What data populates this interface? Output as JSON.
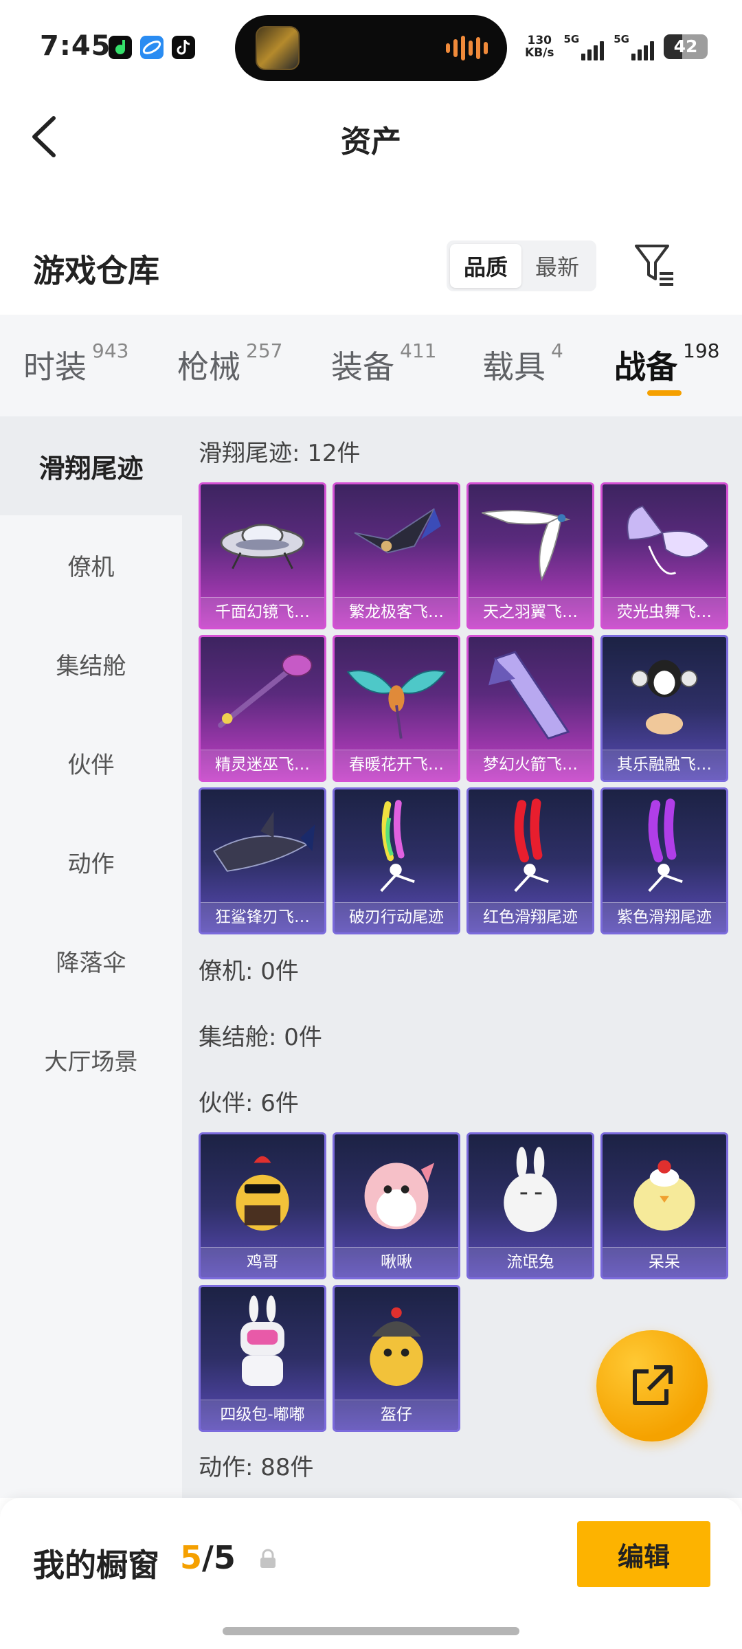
{
  "status_bar": {
    "time": "7:45",
    "net_speed_value": "130",
    "net_speed_unit": "KB/s",
    "sim1": "5G",
    "sim2": "5G",
    "battery": "42",
    "battery_level": 0.42,
    "app_icons": [
      "music-app-icon",
      "browser-app-icon",
      "tiktok-icon"
    ]
  },
  "nav": {
    "title": "资产"
  },
  "warehouse": {
    "title": "游戏仓库",
    "sort_options": [
      "品质",
      "最新"
    ],
    "sort_active": "品质"
  },
  "category_tabs": [
    {
      "label": "时装",
      "count": "943"
    },
    {
      "label": "枪械",
      "count": "257"
    },
    {
      "label": "装备",
      "count": "411"
    },
    {
      "label": "载具",
      "count": "4"
    },
    {
      "label": "战备",
      "count": "198",
      "active": true
    }
  ],
  "side_menu": [
    "滑翔尾迹",
    "僚机",
    "集结舱",
    "伙伴",
    "动作",
    "降落伞",
    "大厅场景"
  ],
  "side_menu_active": "滑翔尾迹",
  "sections": {
    "glide_trail": {
      "label": "滑翔尾迹: 12件",
      "items": [
        {
          "name": "千面幻镜飞…",
          "rarity": "purple",
          "icon": "ufo-glider-icon"
        },
        {
          "name": "繁龙极客飞…",
          "rarity": "purple",
          "icon": "dragon-glider-icon"
        },
        {
          "name": "天之羽翼飞…",
          "rarity": "purple",
          "icon": "feather-wing-icon"
        },
        {
          "name": "荧光虫舞飞…",
          "rarity": "purple",
          "icon": "butterfly-wing-icon"
        },
        {
          "name": "精灵迷巫飞…",
          "rarity": "purple",
          "icon": "broom-icon"
        },
        {
          "name": "春暖花开飞…",
          "rarity": "purple",
          "icon": "dragonfly-icon"
        },
        {
          "name": "梦幻火箭飞…",
          "rarity": "purple",
          "icon": "rocket-glider-icon"
        },
        {
          "name": "其乐融融飞…",
          "rarity": "blue",
          "icon": "penguin-glider-icon"
        },
        {
          "name": "狂鲨锋刃飞…",
          "rarity": "blue",
          "icon": "shark-glider-icon"
        },
        {
          "name": "破刃行动尾迹",
          "rarity": "blue",
          "icon": "rainbow-trail-icon"
        },
        {
          "name": "红色滑翔尾迹",
          "rarity": "blue",
          "icon": "red-trail-icon"
        },
        {
          "name": "紫色滑翔尾迹",
          "rarity": "blue",
          "icon": "purple-trail-icon"
        }
      ]
    },
    "wingman": {
      "label": "僚机: 0件"
    },
    "capsule": {
      "label": "集结舱: 0件"
    },
    "companion": {
      "label": "伙伴: 6件",
      "items": [
        {
          "name": "鸡哥",
          "rarity": "blue",
          "icon": "chicken-icon"
        },
        {
          "name": "啾啾",
          "rarity": "blue",
          "icon": "pink-bird-icon"
        },
        {
          "name": "流氓兔",
          "rarity": "blue",
          "icon": "rabbit-icon"
        },
        {
          "name": "呆呆",
          "rarity": "blue",
          "icon": "chick-icon"
        },
        {
          "name": "四级包-嘟嘟",
          "rarity": "blue",
          "icon": "robot-rabbit-icon"
        },
        {
          "name": "盔仔",
          "rarity": "blue",
          "icon": "helmet-chick-icon"
        }
      ]
    },
    "emote": {
      "label": "动作: 88件"
    }
  },
  "bottom_bar": {
    "title": "我的橱窗",
    "count_current": "5",
    "count_sep_total": "/5",
    "edit_label": "编辑"
  },
  "colors": {
    "accent": "#f5a000",
    "rarity_purple": "#d451d4",
    "rarity_blue": "#7b6bdc"
  }
}
